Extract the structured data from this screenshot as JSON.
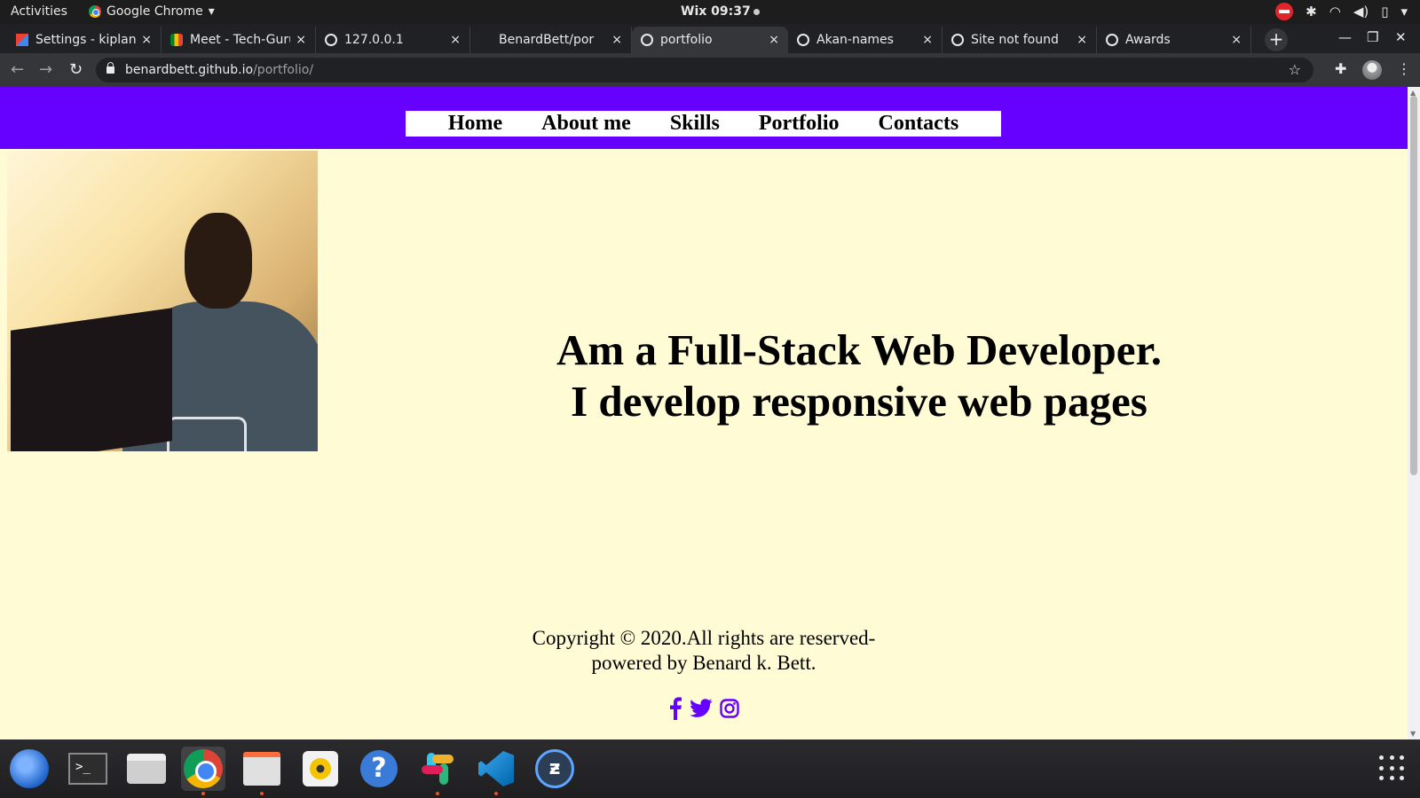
{
  "system_bar": {
    "activities": "Activities",
    "app_name": "Google Chrome",
    "app_dropdown": "▾",
    "clock": "Wix 09:37"
  },
  "browser": {
    "tabs": [
      {
        "title": "Settings - kiplan",
        "favicon": "gmail-icon",
        "active": false
      },
      {
        "title": "Meet - Tech-Guru",
        "favicon": "meet-icon",
        "active": false
      },
      {
        "title": "127.0.0.1",
        "favicon": "globe-icon",
        "active": false
      },
      {
        "title": "BenardBett/por",
        "favicon": "none",
        "active": false
      },
      {
        "title": "portfolio",
        "favicon": "globe-icon",
        "active": true
      },
      {
        "title": "Akan-names",
        "favicon": "globe-icon",
        "active": false
      },
      {
        "title": "Site not found",
        "favicon": "globe-icon",
        "active": false
      },
      {
        "title": "Awards",
        "favicon": "globe-icon",
        "active": false
      }
    ],
    "tab_close": "×",
    "new_tab": "+",
    "url_host": "benardbett.github.io",
    "url_path": "/portfolio/"
  },
  "page": {
    "nav": [
      "Home",
      "About me",
      "Skills",
      "Portfolio",
      "Contacts"
    ],
    "hero_line1": "Am a Full-Stack Web Developer.",
    "hero_line2": "I develop responsive web pages",
    "footer_line1": "Copyright © 2020.All rights are reserved-",
    "footer_line2": "powered by Benard k. Bett.",
    "social": [
      "facebook-icon",
      "twitter-icon",
      "instagram-icon"
    ],
    "accent_color": "#6600ff",
    "background_color": "#fffbd4"
  },
  "dock": {
    "apps": [
      "thunderbird-icon",
      "terminal-icon",
      "printer-icon",
      "chrome-icon",
      "files-icon",
      "rhythmbox-icon",
      "help-icon",
      "slack-icon",
      "vscode-icon",
      "app-icon"
    ]
  }
}
